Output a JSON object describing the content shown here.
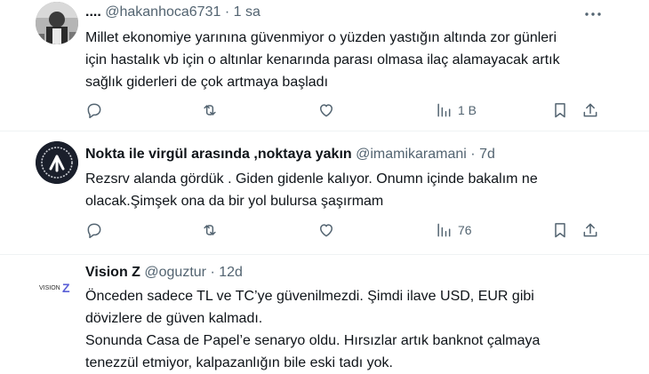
{
  "tweets": [
    {
      "name": "....",
      "handle": "@hakanhoca6731",
      "dot": "·",
      "time": "1 sa",
      "lines": [
        "Millet ekonomiye yarınına güvenmiyor o yüzden yastığın altında zor günleri",
        "için  hastalık vb için o altınlar kenarında parası olmasa ilaç alamayacak artık",
        "sağlık giderleri de çok artmaya başladı"
      ],
      "views": "1 B"
    },
    {
      "name": "Nokta ile virgül arasında ,noktaya yakın",
      "handle": "@imamikaramani",
      "dot": "·",
      "time": "7d",
      "lines": [
        "Rezsrv alanda gördük . Giden gidenle kalıyor. Onumn içinde bakalım ne",
        "olacak.Şimşek ona da bir yol bulursa şaşırmam"
      ],
      "views": "76"
    },
    {
      "name": "Vision Z",
      "handle": "@oguztur",
      "dot": "·",
      "time": "12d",
      "avatar_text": "VISION Z",
      "lines": [
        "Önceden sadece TL ve TC’ye güvenilmezdi. Şimdi ilave USD, EUR gibi",
        "dövizlere de güven kalmadı.",
        "Sonunda Casa de Papel’e senaryo oldu. Hırsızlar artık banknot çalmaya",
        "tenezzül etmiyor, kalpazanlığın bile eski tadı yok."
      ]
    }
  ],
  "icons": {
    "reply": "reply-icon",
    "retweet": "retweet-icon",
    "like": "like-icon",
    "views": "views-icon",
    "bookmark": "bookmark-icon",
    "share": "share-icon",
    "more": "more-icon"
  },
  "colors": {
    "text": "#0f1419",
    "secondary": "#536471",
    "divider": "#eff3f4"
  }
}
